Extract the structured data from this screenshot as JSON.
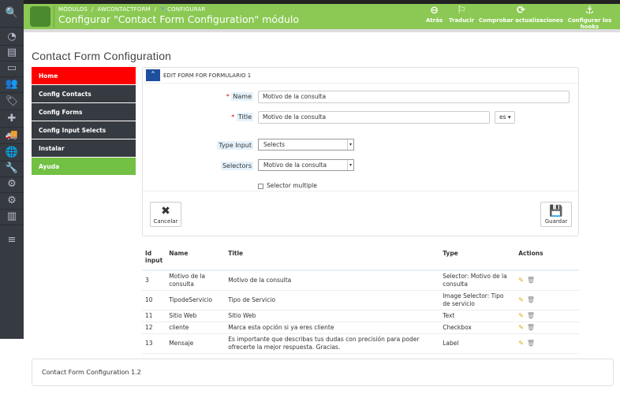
{
  "header": {
    "breadcrumb": [
      "MÓDULOS",
      "AWCONTACTFORM",
      "CONFIGURAR"
    ],
    "title": "Configurar \"Contact Form Configuration\" módulo",
    "toolbar": [
      {
        "label": "Atrás",
        "icon": "arrow-left-circle-icon",
        "glyph": "⊖"
      },
      {
        "label": "Traducir",
        "icon": "flag-icon",
        "glyph": "⚐"
      },
      {
        "label": "Comprobar actualizaciones",
        "icon": "refresh-icon",
        "glyph": "⟳"
      },
      {
        "label": "Configurar los hooks",
        "icon": "anchor-icon",
        "glyph": "⚓"
      }
    ]
  },
  "sidebar": {
    "icons": [
      "search-icon",
      "dashboard-icon",
      "catalog-icon",
      "orders-icon",
      "customers-icon",
      "tags-icon",
      "modules-icon",
      "shipping-icon",
      "localization-icon",
      "tools-icon",
      "settings-icon",
      "advanced-settings-icon",
      "stats-icon",
      "menu-icon"
    ]
  },
  "page_title": "Contact Form Configuration",
  "menu": [
    "Home",
    "Config Contacts",
    "Config Forms",
    "Config Input Selects",
    "Instalar",
    "Ayuda"
  ],
  "panel": {
    "heading": "EDIT FORM FOR FORMULARIO 1",
    "name_label": "Name",
    "name_value": "Motivo de la consulta",
    "title_label": "Title",
    "title_value": "Motivo de la consulta",
    "lang": "es",
    "type_label": "Type Input",
    "type_value": "Selects",
    "selectors_label": "Selectors",
    "selectors_value": "Motivo de la consulta",
    "multiple_label": "Selector multiple",
    "cancel": "Cancelar",
    "save": "Guardar"
  },
  "table": {
    "headers": [
      "Id input",
      "Name",
      "Title",
      "Type",
      "Actions"
    ],
    "rows": [
      [
        "3",
        "Motivo de la consulta",
        "Motivo de la consulta",
        "Selector: Motivo de la consulta"
      ],
      [
        "10",
        "TipodeServicio",
        "Tipo de Servicio",
        "Image Selector: Tipo de servicio"
      ],
      [
        "11",
        "Sitio Web",
        "Sitio Web",
        "Text"
      ],
      [
        "12",
        "cliente",
        "Marca esta opción si ya eres cliente",
        "Checkbox"
      ],
      [
        "13",
        "Mensaje",
        "Es importante que describas tus dudas con precisión para poder ofrecerte la mejor respuesta. Gracias.",
        "Label"
      ]
    ]
  },
  "footer": "Contact Form Configuration 1.2",
  "colors": {
    "header": "#8bc954",
    "home": "#ff0000",
    "ayuda": "#72c044",
    "sidebar": "#363a41"
  }
}
